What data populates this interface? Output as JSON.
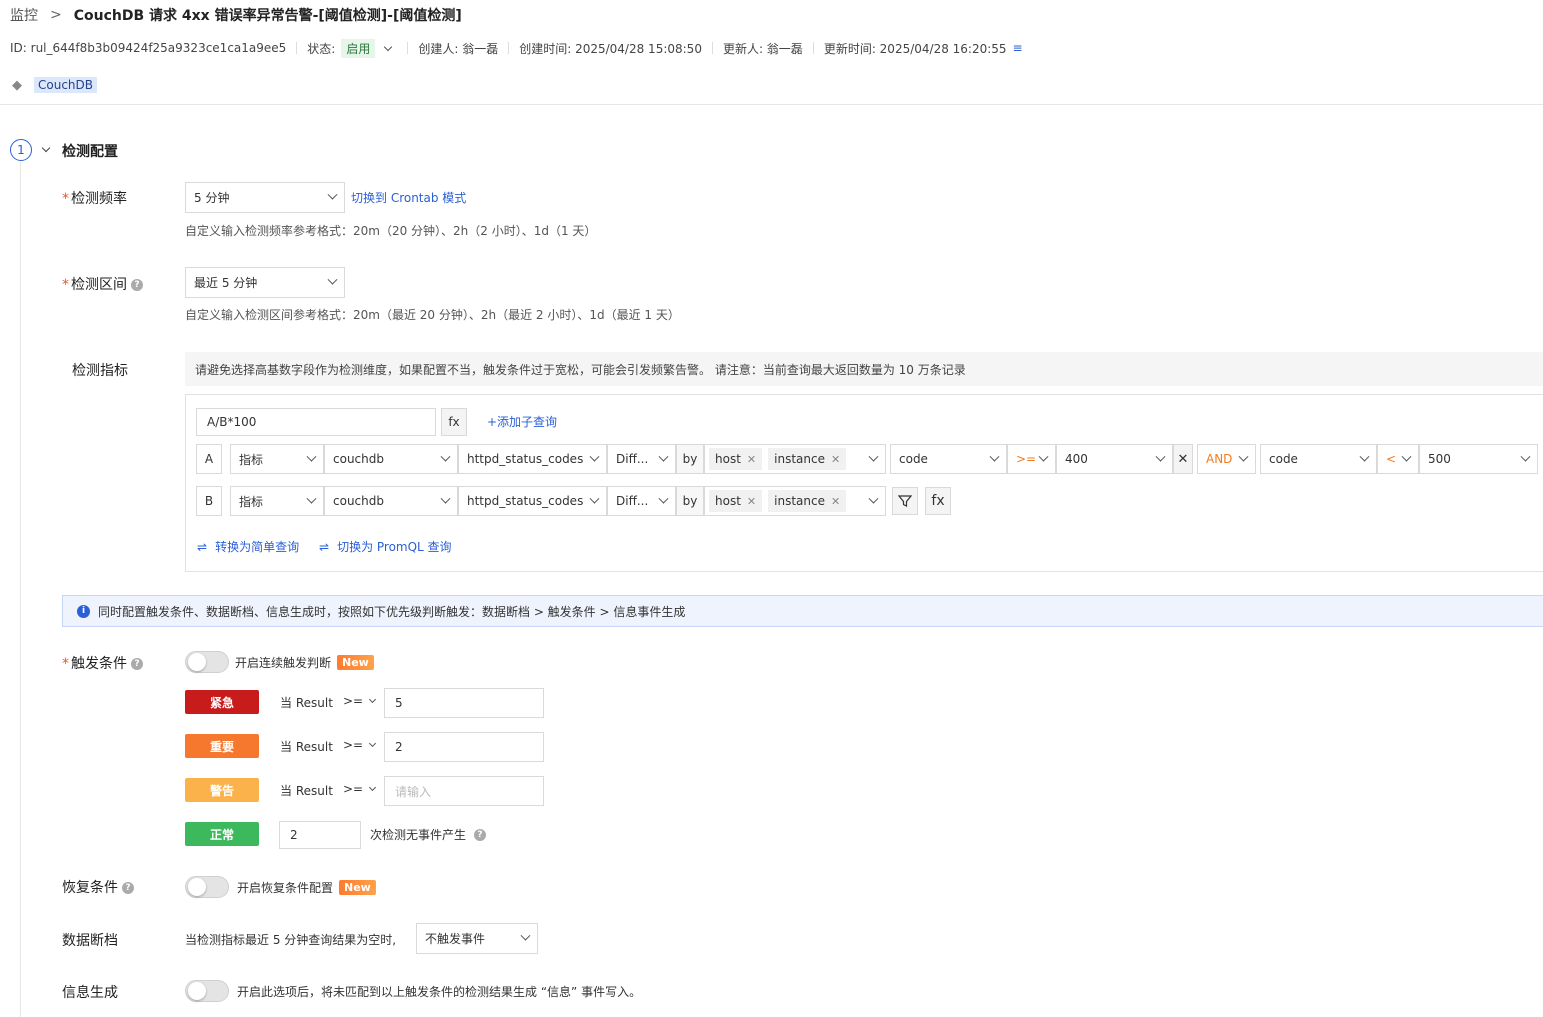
{
  "breadcrumb": {
    "parent": "监控",
    "separator": ">",
    "title": "CouchDB 请求 4xx 错误率异常告警-[阈值检测]-[阈值检测]"
  },
  "meta": {
    "id": "ID: rul_644f8b3b09424f25a9323ce1ca1a9ee5",
    "status_label": "状态:",
    "status_value": "启用",
    "creator": "创建人: 翁一磊",
    "created_at": "创建时间: 2025/04/28 15:08:50",
    "updater": "更新人: 翁一磊",
    "updated_at": "更新时间: 2025/04/28 16:20:55"
  },
  "tag": "CouchDB",
  "section": {
    "step": "1",
    "title": "检测配置"
  },
  "frequency": {
    "label": "检测频率",
    "value": "5 分钟",
    "switch_link": "切换到 Crontab 模式",
    "hint": "自定义输入检测频率参考格式：20m（20 分钟）、2h（2 小时）、1d（1 天）"
  },
  "interval": {
    "label": "检测区间",
    "value": "最近 5 分钟",
    "hint": "自定义输入检测区间参考格式：20m（最近 20 分钟）、2h（最近 2 小时）、1d（最近 1 天）"
  },
  "metrics": {
    "label": "检测指标",
    "notice": "请避免选择高基数字段作为检测维度，如果配置不当，触发条件过于宽松，可能会引发频繁告警。 请注意：当前查询最大返回数量为 10 万条记录",
    "expression": "A/B*100",
    "fx": "fx",
    "add_subquery": "+添加子查询",
    "queries": [
      {
        "letter": "A",
        "type": "指标",
        "source": "couchdb",
        "metric": "httpd_status_codes",
        "func": "Diff...",
        "by": "by",
        "dims": [
          "host",
          "instance"
        ],
        "filter1": {
          "field": "code",
          "op": ">=",
          "value": "400"
        },
        "logic": "AND",
        "filter2": {
          "field": "code",
          "op": "<",
          "value": "500"
        }
      },
      {
        "letter": "B",
        "type": "指标",
        "source": "couchdb",
        "metric": "httpd_status_codes",
        "func": "Diff...",
        "by": "by",
        "dims": [
          "host",
          "instance"
        ]
      }
    ],
    "to_simple": "转换为简单查询",
    "to_promql": "切换为 PromQL 查询"
  },
  "info_banner": "同时配置触发条件、数据断档、信息生成时，按照如下优先级判断触发：数据断档 > 触发条件 > 信息事件生成",
  "trigger": {
    "label": "触发条件",
    "toggle_text": "开启连续触发判断",
    "new_badge": "New",
    "rules": [
      {
        "level": "紧急",
        "color": "#c81c1c",
        "when": "当 Result",
        "op": ">=",
        "value": "5",
        "placeholder": ""
      },
      {
        "level": "重要",
        "color": "#f6782f",
        "when": "当 Result",
        "op": ">=",
        "value": "2",
        "placeholder": ""
      },
      {
        "level": "警告",
        "color": "#fbb24a",
        "when": "当 Result",
        "op": ">=",
        "value": "",
        "placeholder": "请输入"
      }
    ],
    "normal": {
      "level": "正常",
      "color": "#3cb95c",
      "value": "2",
      "text": "次检测无事件产生"
    }
  },
  "recovery": {
    "label": "恢复条件",
    "toggle_text": "开启恢复条件配置",
    "new_badge": "New"
  },
  "nodata": {
    "label": "数据断档",
    "text": "当检测指标最近 5 分钟查询结果为空时,",
    "value": "不触发事件"
  },
  "info_gen": {
    "label": "信息生成",
    "text": "开启此选项后，将未匹配到以上触发条件的检测结果生成 “信息” 事件写入。"
  }
}
